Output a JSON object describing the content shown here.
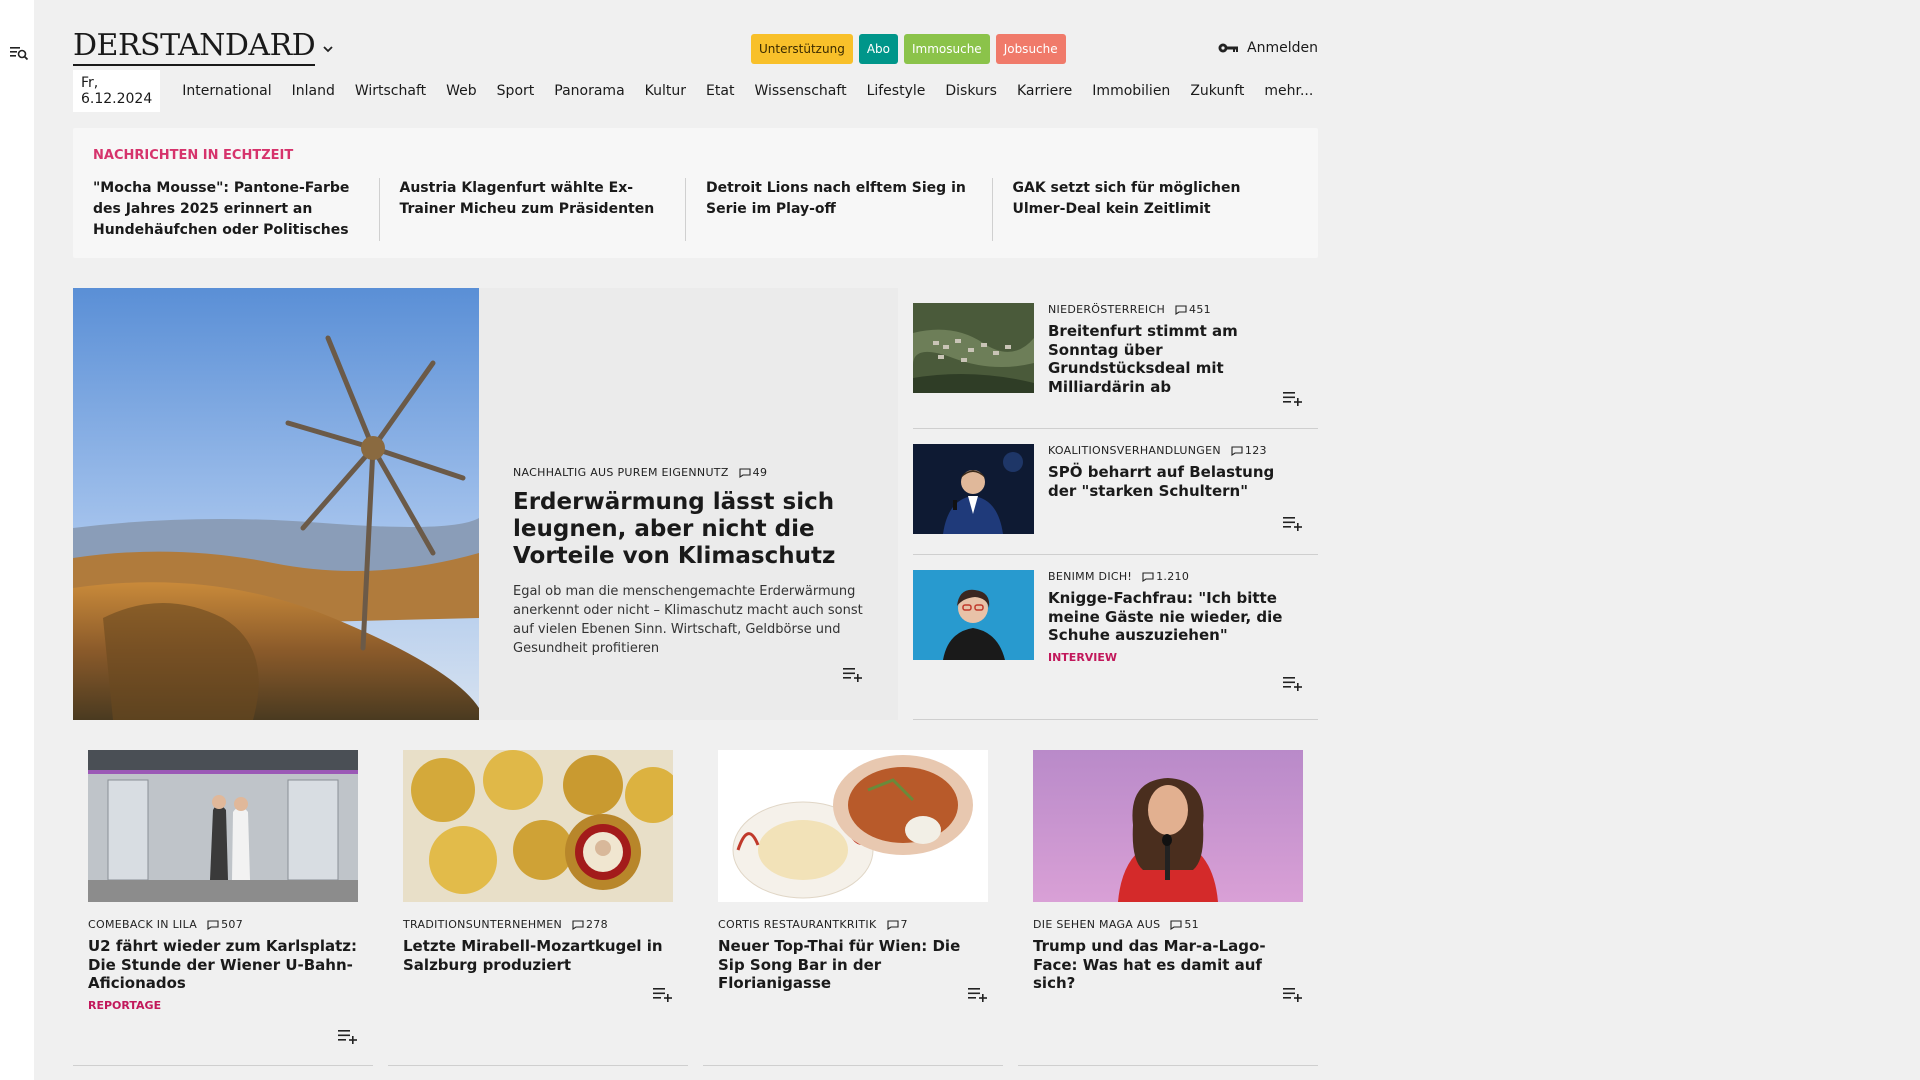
{
  "header": {
    "logo": "DERSTANDARD",
    "service_buttons": {
      "support": "Unterstützung",
      "abo": "Abo",
      "immo": "Immosuche",
      "jobs": "Jobsuche"
    },
    "login_label": "Anmelden"
  },
  "nav": {
    "date": "Fr, 6.12.2024",
    "items": [
      "International",
      "Inland",
      "Wirtschaft",
      "Web",
      "Sport",
      "Panorama",
      "Kultur",
      "Etat",
      "Wissenschaft",
      "Lifestyle",
      "Diskurs",
      "Karriere",
      "Immobilien",
      "Zukunft",
      "mehr..."
    ]
  },
  "breaking": {
    "title": "NACHRICHTEN IN ECHTZEIT",
    "items": [
      "\"Mocha Mousse\": Pantone-Farbe des Jahres 2025 erinnert an Hundehäuf­chen oder Politisches",
      "Austria Klagenfurt wählte Ex-Trainer Micheu zum Präsidenten",
      "Detroit Lions nach elftem Sieg in Serie im Play-off",
      "GAK setzt sich für möglichen Ulmer-Deal kein Zeitlimit"
    ]
  },
  "hero": {
    "kicker": "NACHHALTIG AUS PUREM EIGENNUTZ",
    "comments": "49",
    "headline": "Erderwärmung lässt sich leugnen, aber nicht die Vorteile von Klimaschutz",
    "teaser": "Egal ob man die menschengemachte Erderwärmung anerkennt oder nicht – Klimaschutz macht auch sonst auf vielen Ebenen Sinn. Wirtschaft, Geldbörse und Gesundheit profitieren"
  },
  "side_stories": [
    {
      "kicker": "NIEDERÖSTERREICH",
      "comments": "451",
      "headline": "Breitenfurt stimmt am Sonntag über Grundstücksdeal mit Milliardärin ab",
      "tag": ""
    },
    {
      "kicker": "KOALITIONSVERHANDLUNGEN",
      "comments": "123",
      "headline": "SPÖ beharrt auf Belastung der \"starken Schultern\"",
      "tag": ""
    },
    {
      "kicker": "BENIMM DICH!",
      "comments": "1.210",
      "headline": "Knigge-Fachfrau: \"Ich bitte meine Gäste nie wieder, die Schuhe auszuziehen\"",
      "tag": "INTERVIEW"
    }
  ],
  "cards": [
    {
      "kicker": "COMEBACK IN LILA",
      "comments": "507",
      "headline": "U2 fährt wieder zum Karlsplatz: Die Stunde der Wiener U-Bahn-Aficionados",
      "tag": "REPORTAGE"
    },
    {
      "kicker": "TRADITIONSUNTERNEHMEN",
      "comments": "278",
      "headline": "Letzte Mirabell-Mozartkugel in Salzburg produziert",
      "tag": ""
    },
    {
      "kicker": "CORTIS RESTAURANTKRITIK",
      "comments": "7",
      "headline": "Neuer Top-Thai für Wien: Die Sip Song Bar in der Florianigasse",
      "tag": ""
    },
    {
      "kicker": "DIE SEHEN MAGA AUS",
      "comments": "51",
      "headline": "Trump und das Mar-a-Lago-Face: Was hat es damit auf sich?",
      "tag": ""
    }
  ],
  "colors": {
    "support": "#f8c02a",
    "abo": "#00968a",
    "immo": "#8bc34a",
    "jobs": "#f07a6a",
    "breaking_title": "#d6336c",
    "tag": "#c2185b"
  }
}
